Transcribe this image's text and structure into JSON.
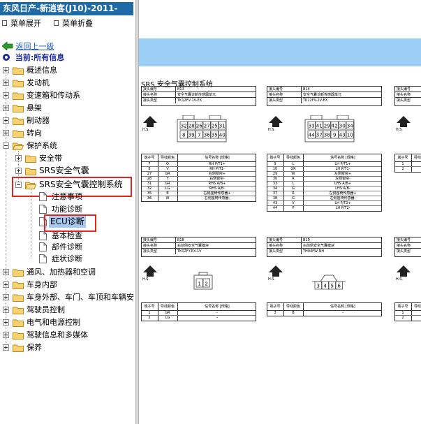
{
  "window": {
    "title": "东风日产-新逍客(J10)-2011-"
  },
  "toolbar": {
    "expand_all": "菜单展开",
    "collapse_all": "菜单折叠"
  },
  "nav": {
    "back_label": "返回上一级",
    "current_label": "当前:所有信息"
  },
  "tree": {
    "root_items": [
      {
        "label": "概述信息"
      },
      {
        "label": "发动机"
      },
      {
        "label": "变速箱和传动系"
      },
      {
        "label": "悬架"
      },
      {
        "label": "制动器"
      },
      {
        "label": "转向"
      },
      {
        "label": "保护系统"
      }
    ],
    "protection_children": [
      {
        "label": "安全带"
      },
      {
        "label": "SRS安全气囊"
      },
      {
        "label": "SRS安全气囊控制系统"
      }
    ],
    "srs_control_children": [
      {
        "label": "注意事项"
      },
      {
        "label": "功能诊断"
      },
      {
        "label": "ECU诊断"
      },
      {
        "label": "基本检查"
      },
      {
        "label": "部件诊断"
      },
      {
        "label": "症状诊断"
      }
    ],
    "root_items_after": [
      {
        "label": "通风、加热器和空调"
      },
      {
        "label": "车身内部"
      },
      {
        "label": "车身外部、车门、车顶和车辆安"
      },
      {
        "label": "驾驶员控制"
      },
      {
        "label": "电气和电源控制"
      },
      {
        "label": "驾驶信息和多媒体"
      },
      {
        "label": "保养"
      }
    ]
  },
  "content": {
    "diagram_title": "SRS 安全气囊控制系统",
    "hs_label": "H.S.",
    "info_keys": [
      "接头编号",
      "接头名称",
      "接头类型"
    ],
    "table_headers": [
      "端子号",
      "导线颜色",
      "信号名称 [规格]"
    ],
    "connectors": [
      {
        "id": "B13",
        "name": "安全气囊诊断传感器单元",
        "type": "TK12FV-1V-EX",
        "pins_top": [
          "32",
          "28",
          "26",
          "27",
          "25",
          "31"
        ],
        "pins_bottom": [
          "8",
          "39",
          "7",
          "36",
          "35",
          "40"
        ],
        "rows": [
          [
            "7",
            "O",
            "RH P/T1+"
          ],
          [
            "8",
            "V",
            "RH P/T1-"
          ],
          [
            "27",
            "GR",
            "右侧窗帘+"
          ],
          [
            "28",
            "Y",
            "右侧窗帘-"
          ],
          [
            "31",
            "GR",
            "RHS A/B+"
          ],
          [
            "32",
            "LG",
            "RHS A/B-"
          ],
          [
            "35",
            "B",
            "右侧座椅传感器+"
          ],
          [
            "36",
            "W",
            "右侧座椅传感器-"
          ]
        ]
      },
      {
        "id": "B14",
        "name": "安全气囊诊断传感器单元",
        "type": "TK12FV-2V-EX",
        "pins_top": [
          "33",
          "41",
          "29",
          "42",
          "30",
          "34"
        ],
        "pins_bottom": [
          "44",
          "37",
          "38",
          "9",
          "43",
          "10"
        ],
        "rows": [
          [
            "9",
            "L",
            "LH P/T1+"
          ],
          [
            "10",
            "GR",
            "LH P/T1-"
          ],
          [
            "29",
            "W",
            "左侧窗帘+"
          ],
          [
            "30",
            "R",
            "左侧窗帘-"
          ],
          [
            "33",
            "L",
            "LHS A/B+"
          ],
          [
            "34",
            "G",
            "LHS A/B-"
          ],
          [
            "37",
            "R",
            "左侧座椅传感器+"
          ],
          [
            "38",
            "G",
            "左侧座椅传感器-"
          ],
          [
            "43",
            "V",
            "LH P/T2+"
          ],
          [
            "44",
            "P",
            "LH P/T2-"
          ]
        ]
      },
      {
        "id": "B18",
        "name": "右前侧安全气囊模块",
        "type": "TK02FY-EX-1V",
        "pins_top": [
          "1",
          "2"
        ],
        "rows": [
          [
            "1",
            "GR",
            "–"
          ],
          [
            "2",
            "LG",
            "–"
          ]
        ]
      },
      {
        "id": "B19",
        "name": "右前侧安全气囊模块",
        "type": "TH04FW-NH",
        "pins_top": [
          "3",
          "4",
          "5",
          "6"
        ],
        "rows": [
          [
            "3",
            "B",
            "–"
          ]
        ]
      }
    ],
    "partial_rows_top": [
      "1",
      "2"
    ],
    "partial_rows_bottom": [
      "1",
      "2"
    ]
  }
}
